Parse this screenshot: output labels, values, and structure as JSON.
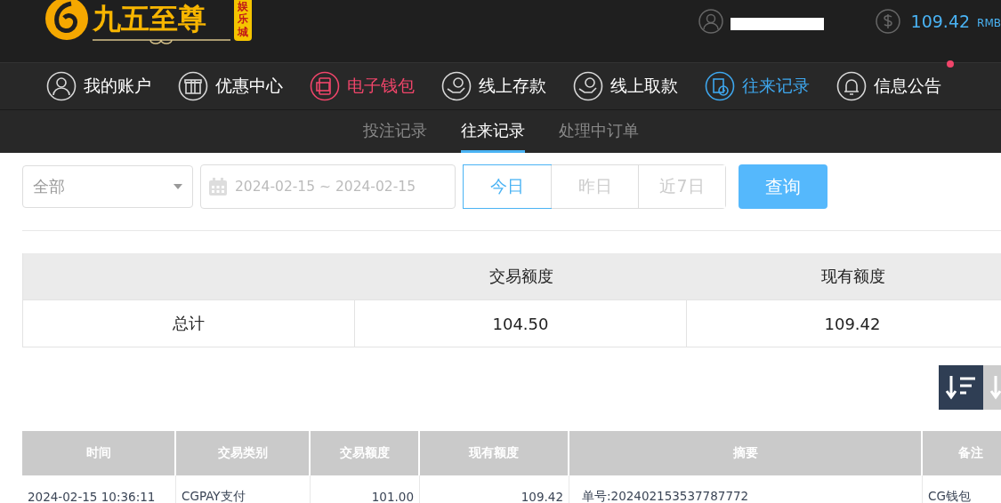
{
  "header": {
    "logo": {
      "title": "九五至尊",
      "badge": "娱乐城"
    },
    "balance": {
      "amount": "109.42",
      "currency": "RMB"
    }
  },
  "nav": [
    {
      "label": "我的账户",
      "kind": "user",
      "selected": false,
      "hovered": false,
      "badge": false
    },
    {
      "label": "优惠中心",
      "kind": "gift",
      "selected": false,
      "hovered": false,
      "badge": false
    },
    {
      "label": "电子钱包",
      "kind": "wallet",
      "selected": false,
      "hovered": true,
      "badge": false
    },
    {
      "label": "线上存款",
      "kind": "deposit",
      "selected": false,
      "hovered": false,
      "badge": false
    },
    {
      "label": "线上取款",
      "kind": "withdraw",
      "selected": false,
      "hovered": false,
      "badge": false
    },
    {
      "label": "往来记录",
      "kind": "record",
      "selected": true,
      "hovered": false,
      "badge": false
    },
    {
      "label": "信息公告",
      "kind": "bell",
      "selected": false,
      "hovered": false,
      "badge": true
    }
  ],
  "subtabs": [
    {
      "label": "投注记录",
      "selected": false
    },
    {
      "label": "往来记录",
      "selected": true
    },
    {
      "label": "处理中订单",
      "selected": false
    }
  ],
  "filter": {
    "type_select": "全部",
    "date_range": "2024-02-15 ~ 2024-02-15",
    "quick_dates": [
      {
        "label": "今日",
        "selected": true
      },
      {
        "label": "昨日",
        "selected": false
      },
      {
        "label": "近7日",
        "selected": false
      }
    ],
    "search_button": "查询"
  },
  "summary": {
    "columns": [
      "",
      "交易额度",
      "现有额度"
    ],
    "rows": [
      [
        "总计",
        "104.50",
        "109.42"
      ]
    ]
  },
  "sort_buttons": [
    {
      "selected": true
    },
    {
      "selected": false
    }
  ],
  "table": {
    "columns": [
      "时间",
      "交易类别",
      "交易额度",
      "现有额度",
      "摘要",
      "备注"
    ],
    "rows": [
      [
        "2024-02-15 10:36:11",
        "CGPAY支付",
        "101.00",
        "109.42",
        "单号:202402153537787772",
        "CG钱包"
      ]
    ]
  }
}
